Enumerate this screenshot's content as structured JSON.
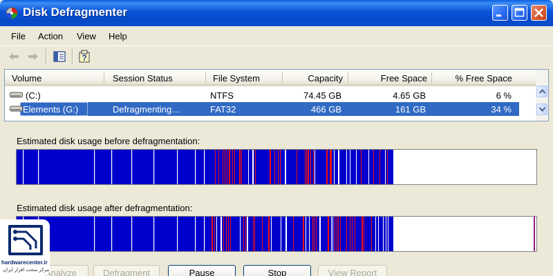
{
  "window": {
    "title": "Disk Defragmenter",
    "buttons": [
      "minimize",
      "maximize",
      "close"
    ]
  },
  "menu": {
    "items": [
      {
        "label": "File"
      },
      {
        "label": "Action"
      },
      {
        "label": "View"
      },
      {
        "label": "Help"
      }
    ]
  },
  "toolbar": {
    "icons": [
      "back-arrow-icon",
      "forward-arrow-icon",
      "show-hide-tree-icon",
      "help-icon"
    ]
  },
  "volumes": {
    "columns": [
      "Volume",
      "Session Status",
      "File System",
      "Capacity",
      "Free Space",
      "% Free Space"
    ],
    "rows": [
      {
        "volume": "(C:)",
        "status": "",
        "fs": "NTFS",
        "capacity": "74.45 GB",
        "free": "4.65 GB",
        "pct": "6 %"
      },
      {
        "volume": "Elements (G:)",
        "status": "Defragmenting…",
        "fs": "FAT32",
        "capacity": "466 GB",
        "free": "161 GB",
        "pct": "34 %"
      }
    ],
    "selected_row": 1
  },
  "before": {
    "label": "Estimated disk usage before defragmentation:",
    "used_fraction": 0.725
  },
  "after": {
    "label": "Estimated disk usage after defragmentation:",
    "used_fraction": 0.725
  },
  "buttons": {
    "analyze": "Analyze",
    "defragment": "Defragment",
    "pause": "Pause",
    "stop": "Stop",
    "view_report": "View Report"
  },
  "colors": {
    "contiguous": "#0000CC",
    "fragmented": "#EE1111",
    "free": "#FFFFFF",
    "selection": "#316AC5"
  },
  "watermark": {
    "site": "hardwarecenter.ir",
    "tagline": "مرکز سخت افزار ایران"
  }
}
